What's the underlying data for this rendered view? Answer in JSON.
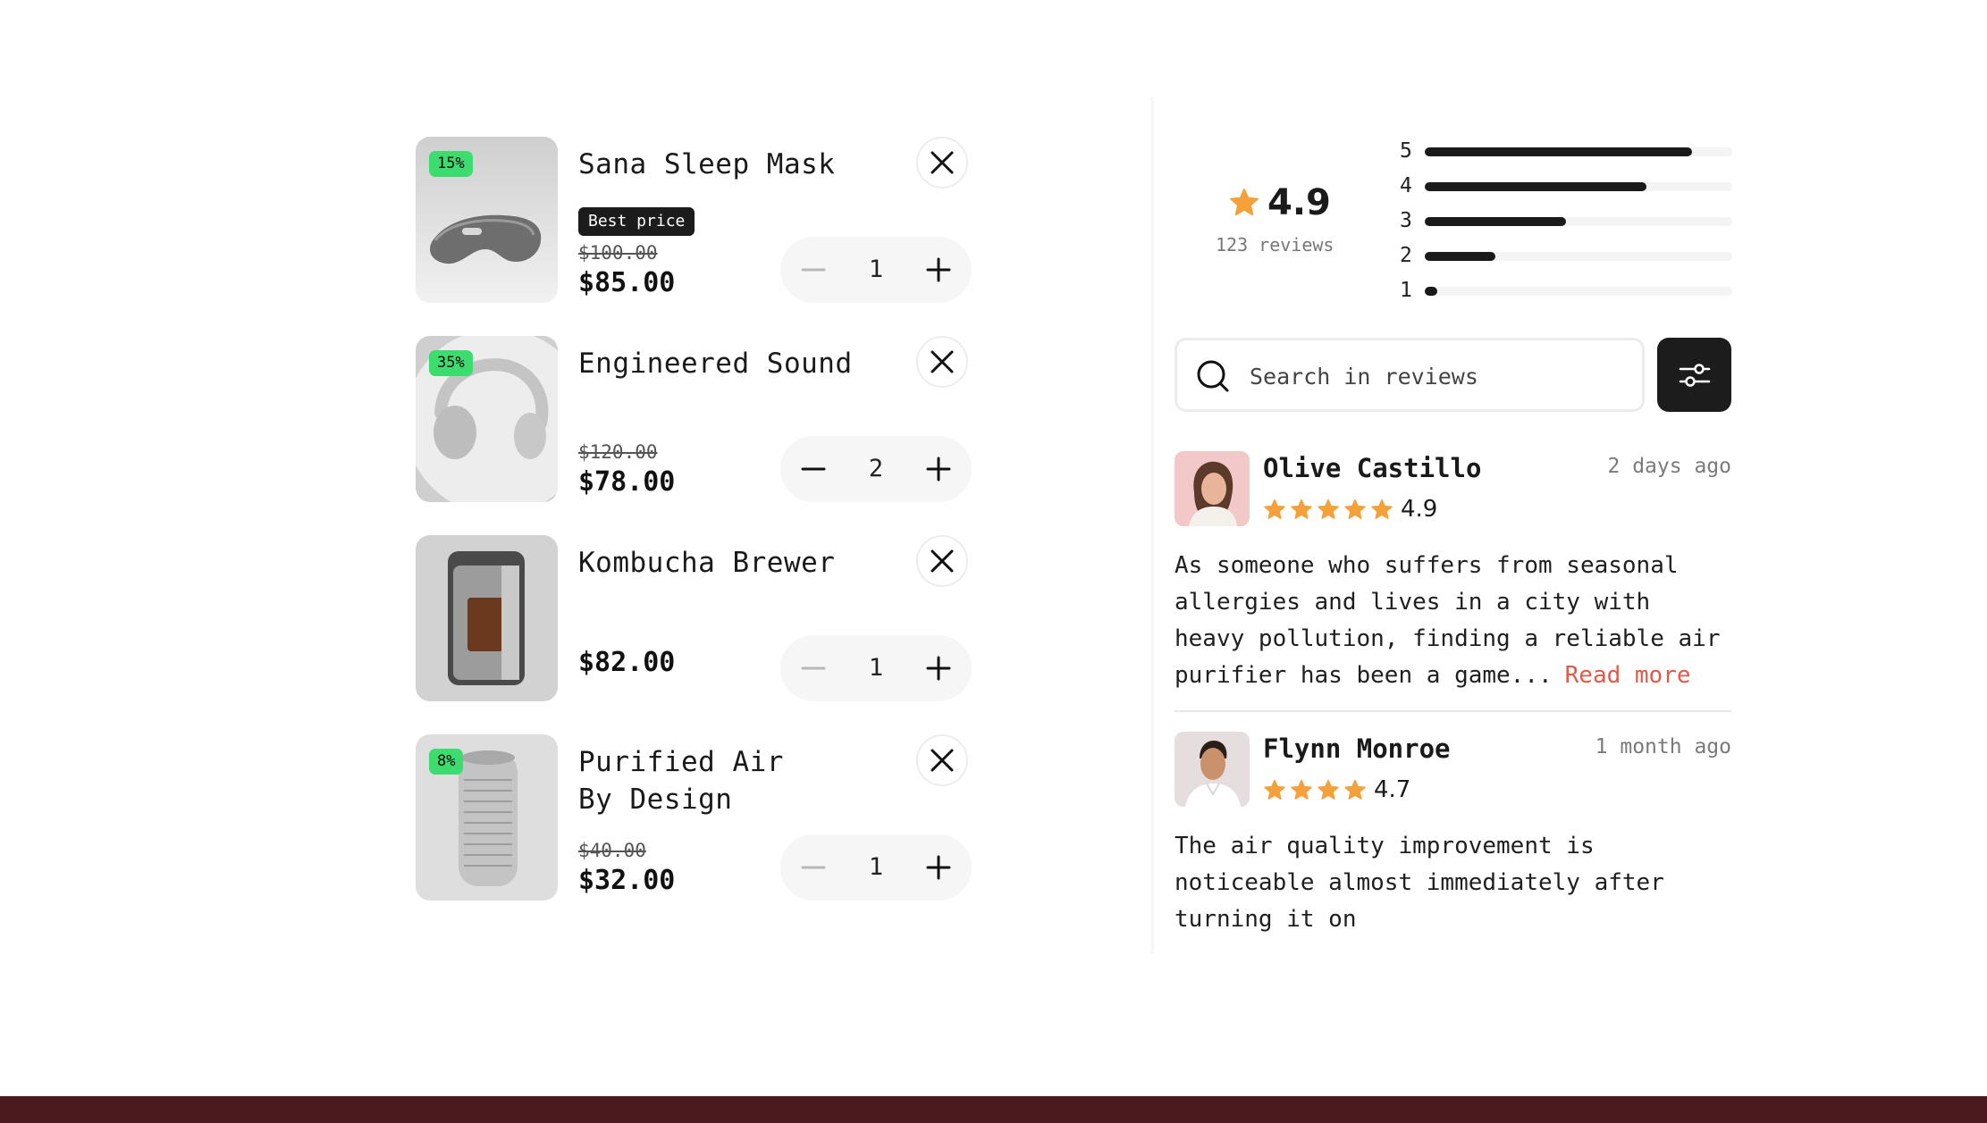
{
  "cart": {
    "items": [
      {
        "title": "Sana Sleep Mask",
        "discount": "15%",
        "badge": "Best price",
        "old_price": "$100.00",
        "price": "$85.00",
        "quantity": "1"
      },
      {
        "title": "Engineered Sound",
        "discount": "35%",
        "badge": "",
        "old_price": "$120.00",
        "price": "$78.00",
        "quantity": "2"
      },
      {
        "title": "Kombucha Brewer",
        "discount": "",
        "badge": "",
        "old_price": "",
        "price": "$82.00",
        "quantity": "1"
      },
      {
        "title_line1": "Purified Air",
        "title_line2": "By Design",
        "discount": "8%",
        "badge": "",
        "old_price": "$40.00",
        "price": "$32.00",
        "quantity": "1"
      }
    ]
  },
  "reviews_summary": {
    "rating": "4.9",
    "count_text": "123 reviews",
    "distribution": [
      {
        "stars": "5",
        "fraction": 0.87
      },
      {
        "stars": "4",
        "fraction": 0.72
      },
      {
        "stars": "3",
        "fraction": 0.46
      },
      {
        "stars": "2",
        "fraction": 0.23
      },
      {
        "stars": "1",
        "fraction": 0.04
      }
    ]
  },
  "search": {
    "placeholder": "Search in reviews"
  },
  "reviews": [
    {
      "name": "Olive Castillo",
      "date": "2 days ago",
      "stars": 5,
      "score": "4.9",
      "text": "As someone who suffers from seasonal allergies and lives in a city with heavy pollution, finding a reliable air purifier has been a game...",
      "read_more": "Read more"
    },
    {
      "name": "Flynn Monroe",
      "date": "1 month ago",
      "stars": 4,
      "score": "4.7",
      "text": "The air quality improvement is noticeable almost immediately after turning it on"
    }
  ],
  "colors": {
    "discount_green": "#3ddc6f",
    "star_orange": "#f4a13c",
    "link_red": "#e05a4a",
    "dark": "#1c1c1c",
    "footer": "#4a1a1f"
  },
  "icons": {
    "remove": "close-icon",
    "minus": "minus-icon",
    "plus": "plus-icon",
    "search": "search-icon",
    "filter": "sliders-icon",
    "star": "star-icon"
  }
}
